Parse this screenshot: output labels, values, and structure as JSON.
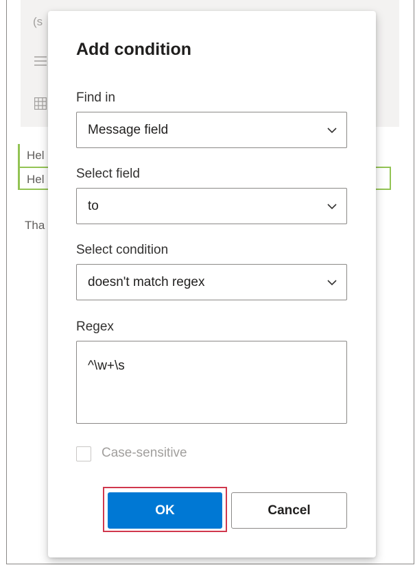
{
  "background": {
    "partial_top_text": "(s",
    "row1_text": "Hel",
    "row2_text": "Hel",
    "row3_text": "Tha",
    "icons": [
      "menu-icon",
      "table-icon"
    ]
  },
  "dialog": {
    "title": "Add condition",
    "find_in": {
      "label": "Find in",
      "value": "Message field"
    },
    "select_field": {
      "label": "Select field",
      "value": "to"
    },
    "select_condition": {
      "label": "Select condition",
      "value": "doesn't match regex"
    },
    "regex": {
      "label": "Regex",
      "value": "^\\w+\\s"
    },
    "case_sensitive": {
      "label": "Case-sensitive",
      "checked": false,
      "disabled": true
    },
    "buttons": {
      "ok": "OK",
      "cancel": "Cancel"
    }
  },
  "colors": {
    "primary": "#0078d4",
    "focus_ring": "#d0374c",
    "highlight_border": "#92c353"
  }
}
